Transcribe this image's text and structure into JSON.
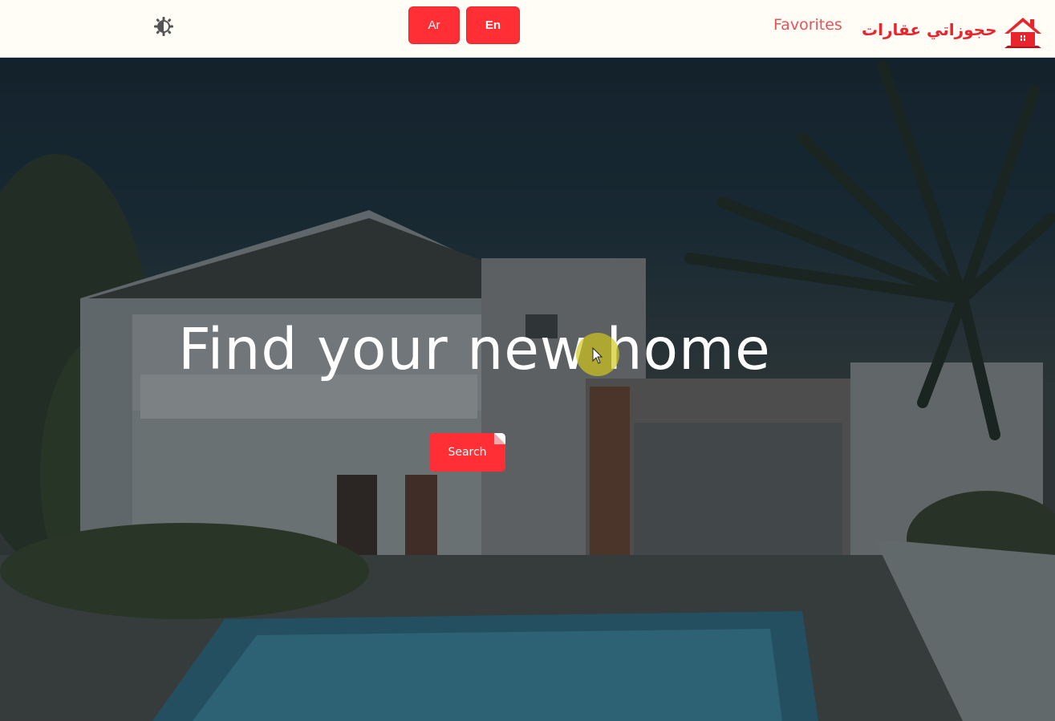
{
  "header": {
    "brand_text": "حجوزاتي عقارات",
    "favorites_label": "Favorites",
    "lang_ar_label": "Ar",
    "lang_en_label": "En",
    "theme_icon": "theme-toggle-icon",
    "logo_icon": "house-logo-icon"
  },
  "hero": {
    "title": "Find your new home",
    "search_label": "Search"
  },
  "colors": {
    "accent": "#ff2f35",
    "link": "#e8535a",
    "navbar_bg": "#fffdf6"
  }
}
